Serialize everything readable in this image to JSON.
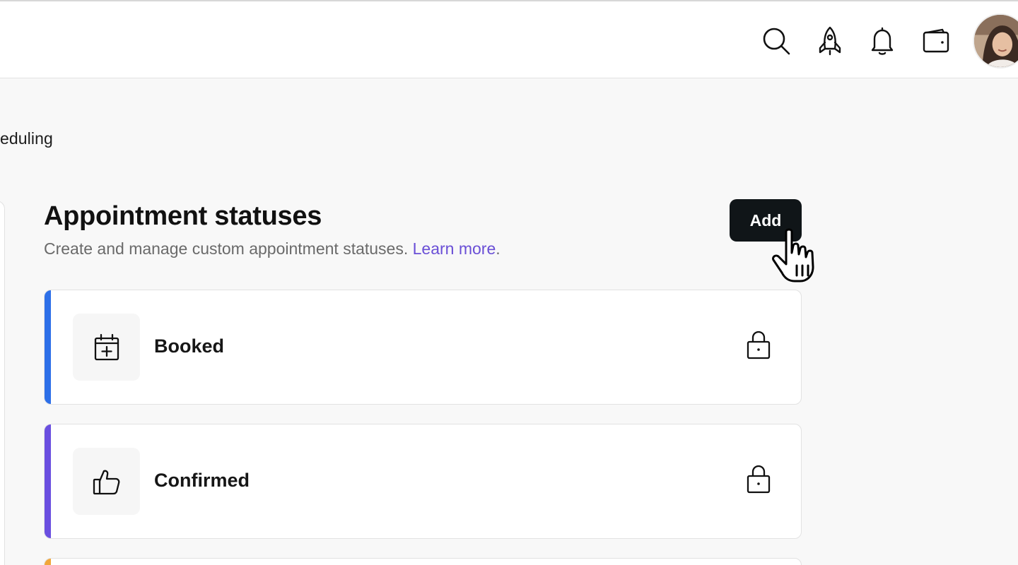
{
  "header": {
    "icons": [
      "search-icon",
      "rocket-icon",
      "bell-icon",
      "wallet-icon"
    ],
    "avatar": "avatar"
  },
  "breadcrumb": {
    "text": "eduling"
  },
  "section": {
    "title": "Appointment statuses",
    "description": "Create and manage custom appointment statuses. ",
    "learn_more": "Learn more",
    "period": ".",
    "add_label": "Add"
  },
  "statuses": [
    {
      "label": "Booked",
      "icon": "calendar-plus-icon",
      "color": "#2d6fe8",
      "locked": true
    },
    {
      "label": "Confirmed",
      "icon": "thumbs-up-icon",
      "color": "#6a4fe0",
      "locked": true
    },
    {
      "label": "",
      "icon": "",
      "color": "#f0a63a",
      "locked": false
    }
  ],
  "colors": {
    "accent": "#6a4fd6",
    "button_bg": "#101518",
    "page_bg": "#f8f8f8"
  }
}
